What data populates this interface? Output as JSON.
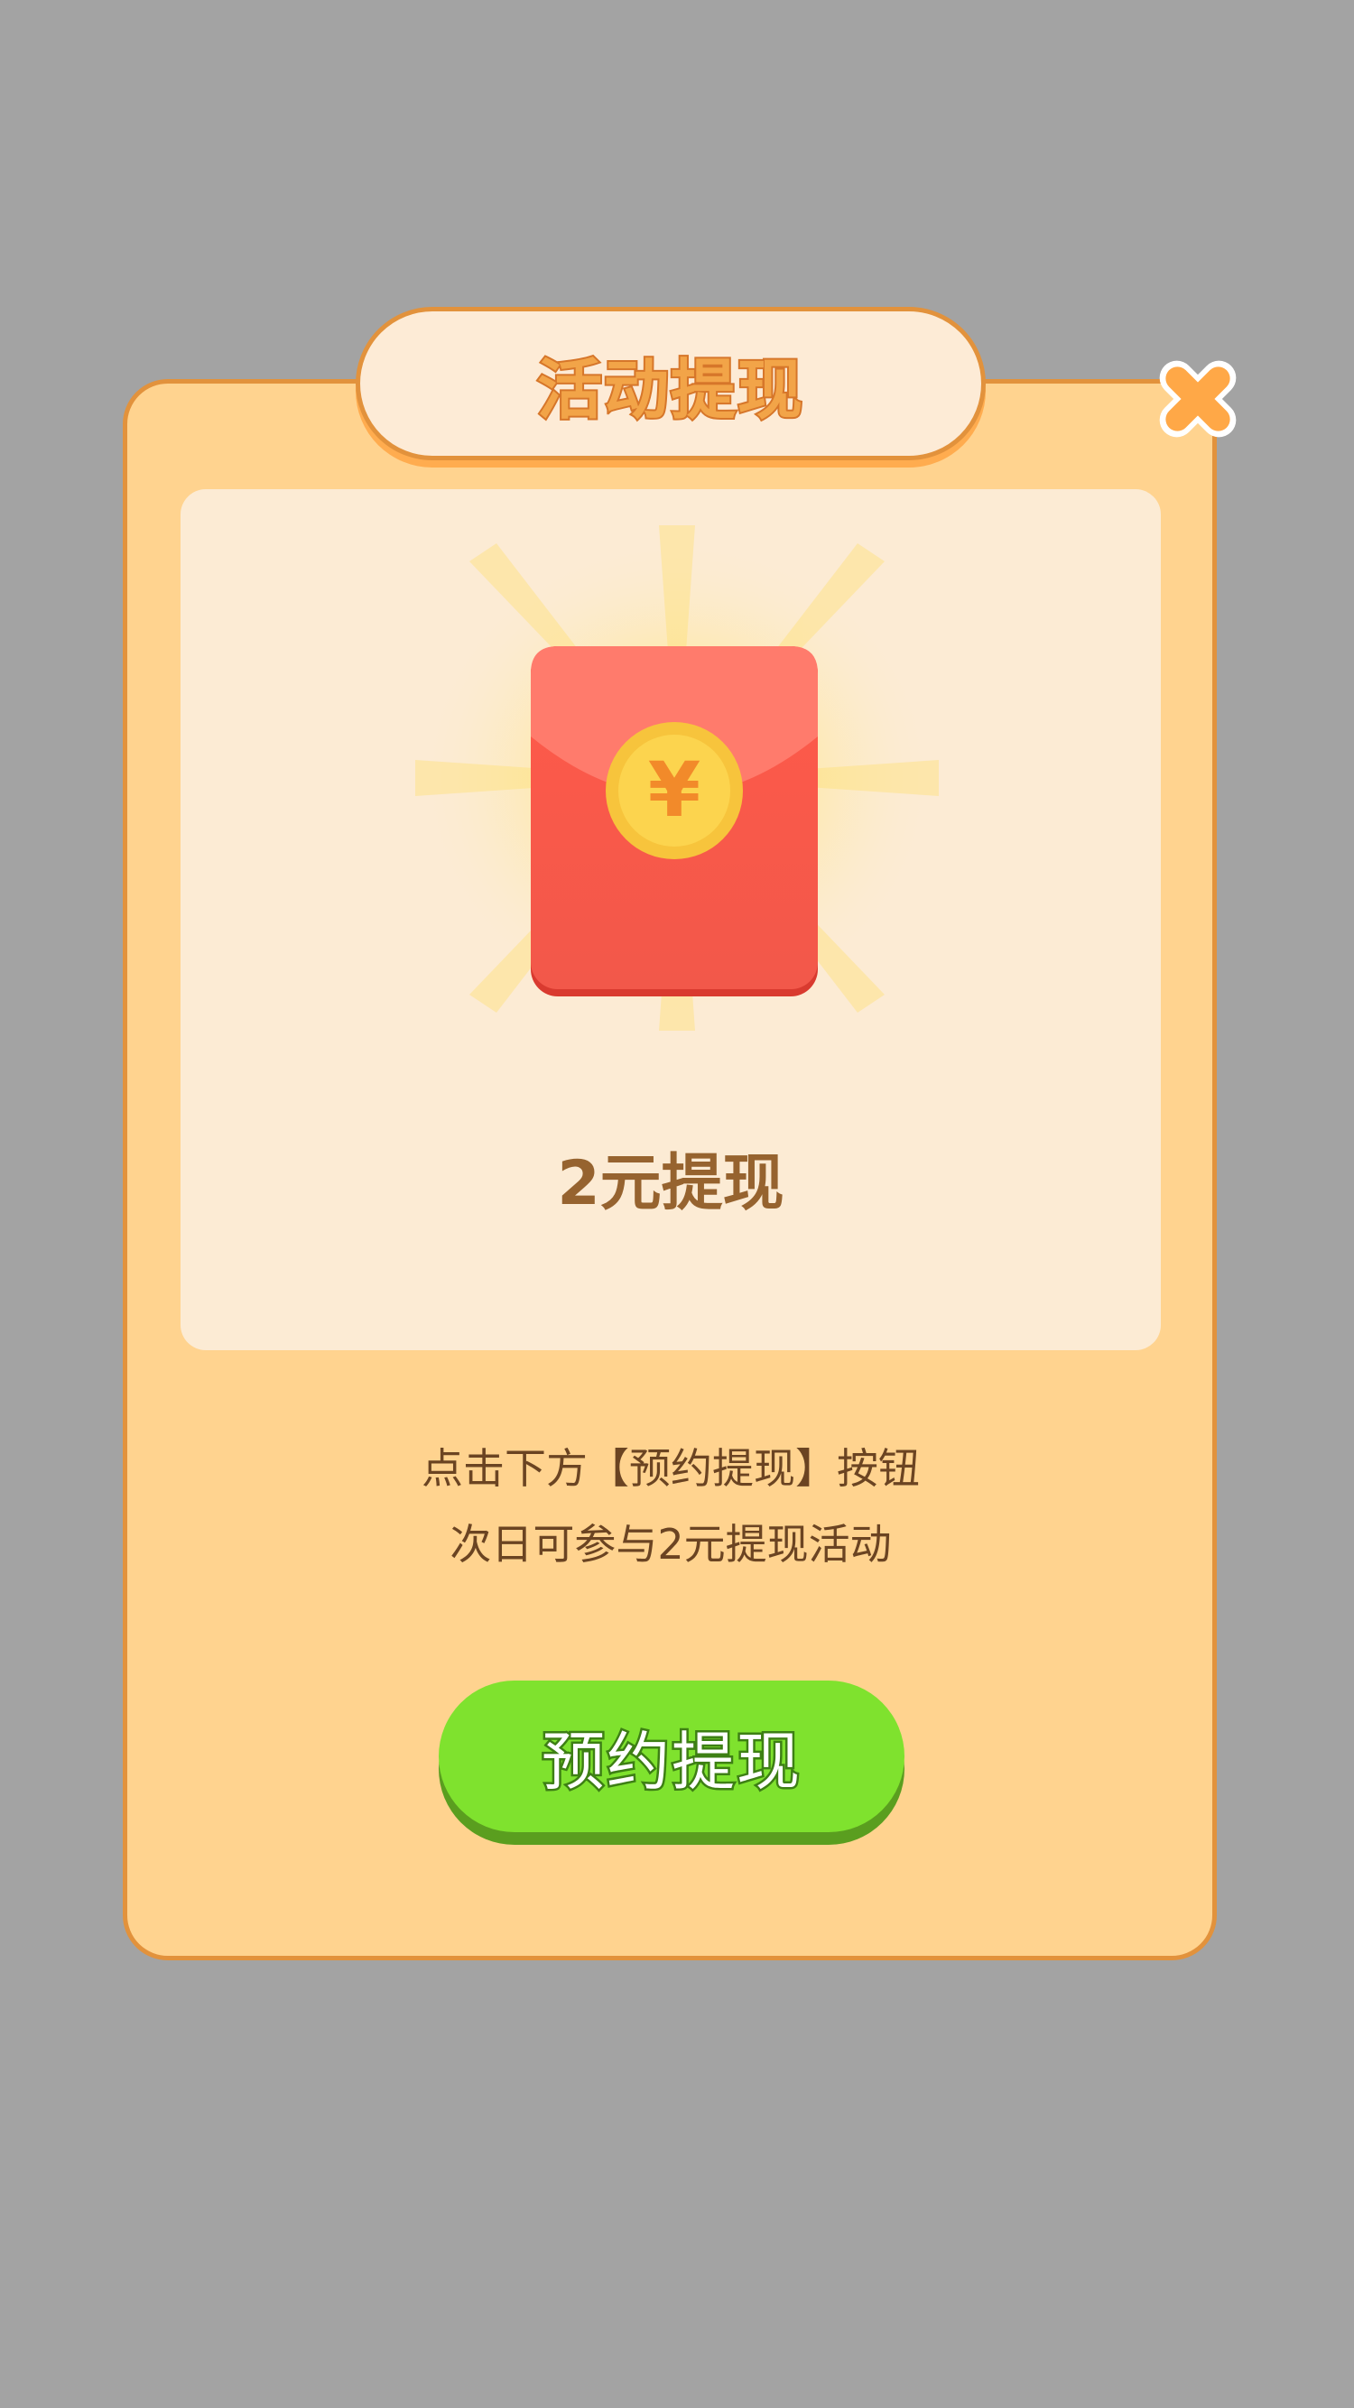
{
  "dialog": {
    "title": "活动提现",
    "reward_amount": "2元提现",
    "description_lines": [
      "点击下方【预约提现】按钮",
      "次日可参与2元提现活动"
    ],
    "button_label": "预约提现",
    "close_icon": "close-icon",
    "coin_symbol": "¥"
  },
  "colors": {
    "overlay": "#a3a3a3",
    "panel": "#ffd38f",
    "panel_border": "#e2923c",
    "inner_panel": "#fcebd4",
    "envelope": "#f24b41",
    "coin": "#f9c83c",
    "button": "#7fe22e",
    "close": "#ffa847"
  }
}
